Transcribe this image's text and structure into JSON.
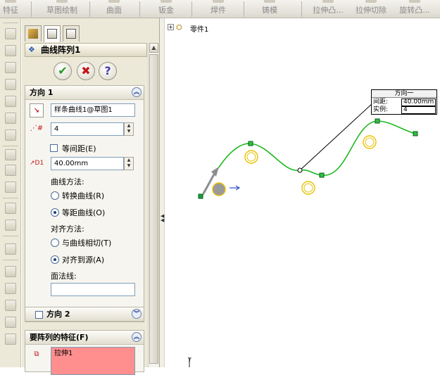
{
  "toolbar": {
    "items": [
      {
        "label": "特征"
      },
      {
        "label": "草图绘制"
      },
      {
        "label": "曲面"
      },
      {
        "label": "钣金"
      },
      {
        "label": "焊件"
      },
      {
        "label": "铸模"
      },
      {
        "label": "拉伸凸..."
      },
      {
        "label": "拉伸切除"
      },
      {
        "label": "旋转凸..."
      }
    ]
  },
  "panel": {
    "title": "曲线阵列1",
    "buttons": {
      "ok": "✔",
      "cancel": "✖",
      "help": "?"
    },
    "direction1": {
      "header": "方向 1",
      "curve_value": "样条曲线1@草图1",
      "count_value": "4",
      "equal_spacing_label": "等间距(E)",
      "distance_value": "40.00mm",
      "curve_method_label": "曲线方法:",
      "option_transform": "转换曲线(R)",
      "option_offset": "等距曲线(O)",
      "align_method_label": "对齐方法:",
      "option_tangent": "与曲线相切(T)",
      "option_align_source": "对齐到源(A)",
      "face_normal_label": "面法线:",
      "face_normal_value": ""
    },
    "direction2": {
      "header": "方向 2"
    },
    "features": {
      "header": "要阵列的特征(F)",
      "item": "拉伸1"
    }
  },
  "tree": {
    "root": "零件1"
  },
  "callout": {
    "title": "方向一",
    "spacing_label": "间距:",
    "spacing_value": "40.00mm",
    "instances_label": "实例:",
    "instances_value": "4"
  },
  "axis_label": "Y",
  "colors": {
    "curve": "#1fb81f",
    "pattern_circle": "#e8c200",
    "panel_bg": "#ece9d8",
    "feature_highlight": "#ff8f8f"
  }
}
